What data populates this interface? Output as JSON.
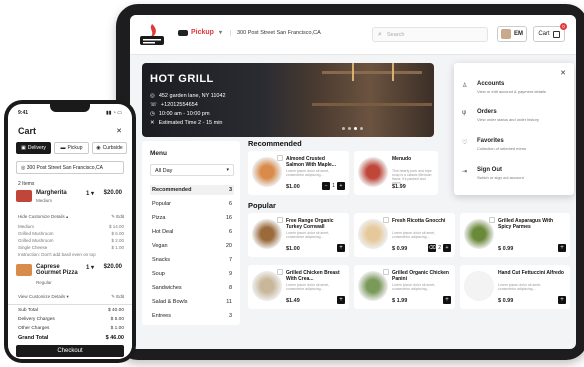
{
  "tablet": {
    "header": {
      "mode_label": "Pickup",
      "address": "300 Post Street San Francisco,CA",
      "search_placeholder": "Search",
      "user_initials": "EM",
      "cart_label": "Cart",
      "cart_count": "0"
    },
    "hero": {
      "title": "HOT GRILL",
      "address": "452 garden lane, NY 11042",
      "phone": "+12012554654",
      "hours": "10:00 am - 10:00 pm",
      "estimate": "Estimated Time 2 - 15 min"
    },
    "account_menu": {
      "items": [
        {
          "title": "Accounts",
          "subtitle": "View or edit account & payment details",
          "icon": "person-icon"
        },
        {
          "title": "Orders",
          "subtitle": "View order status and order history",
          "icon": "fork-knife-icon"
        },
        {
          "title": "Favorites",
          "subtitle": "Collection of selected menu",
          "icon": "heart-icon"
        },
        {
          "title": "Sign Out",
          "subtitle": "Switch or sign out account",
          "icon": "sign-out-icon"
        }
      ]
    },
    "menu": {
      "heading": "Menu",
      "selected_period": "All Day",
      "categories": [
        {
          "name": "Recommended",
          "count": "3"
        },
        {
          "name": "Popular",
          "count": "6"
        },
        {
          "name": "Pizza",
          "count": "16"
        },
        {
          "name": "Hot Deal",
          "count": "6"
        },
        {
          "name": "Vegan",
          "count": "20"
        },
        {
          "name": "Snacks",
          "count": "7"
        },
        {
          "name": "Soup",
          "count": "9"
        },
        {
          "name": "Sandwiches",
          "count": "8"
        },
        {
          "name": "Salad & Bowls",
          "count": "11"
        },
        {
          "name": "Entrees",
          "count": "3"
        }
      ]
    },
    "recommended": {
      "heading": "Recommended",
      "items": [
        {
          "name": "Almond Crusted Salmon With Maple...",
          "desc": "Lorem ipsum dolor sit amet, consectetur adipiscing...",
          "price": "$1.00",
          "qty": "1"
        },
        {
          "name": "Menudo",
          "desc": "This hearty pork and tripe soup is a classic Mexican flavor, it's packed and warm...",
          "price": "$1.99"
        }
      ]
    },
    "popular": {
      "heading": "Popular",
      "items": [
        {
          "name": "Free Range Organic Turkey Cornwall",
          "desc": "Lorem ipsum dolor sit amet, consectetur adipiscing...",
          "price": "$1.00"
        },
        {
          "name": "Fresh Ricotta Gnocchi",
          "desc": "Lorem ipsum dolor sit amet, consectetur adipiscing...",
          "price": "$ 0.99",
          "qty": "2"
        },
        {
          "name": "Grilled Asparagus With Spicy Parmes",
          "desc": "",
          "price": "$ 0.99"
        },
        {
          "name": "Grilled Chicken Breast With Crea...",
          "desc": "Lorem ipsum dolor sit amet, consectetur adipiscing...",
          "price": "$1.49"
        },
        {
          "name": "Grilled Organic Chicken Panini",
          "desc": "Lorem ipsum dolor sit amet, consectetur adipiscing...",
          "price": "$ 1.99"
        },
        {
          "name": "Hand Cut Fettuccini Alfredo",
          "desc": "Lorem ipsum dolor sit amet, consectetur adipiscing...",
          "price": "$ 0.99"
        }
      ]
    }
  },
  "phone": {
    "time": "9:41",
    "title": "Cart",
    "tabs": [
      "Delivery",
      "Pickup",
      "Curbside"
    ],
    "address": "300 Post Street San Francisco,CA",
    "item_count": "2 Items",
    "items": [
      {
        "name": "Margherita",
        "size": "Medium",
        "qty": "1",
        "price": "$20.00"
      },
      {
        "name": "Caprese Gourmet Pizza",
        "size": "Regular",
        "qty": "1",
        "price": "$20.00"
      }
    ],
    "hide_customize": "Hide Customize Details",
    "edit_label": "Edit",
    "view_customize": "View Customize Details",
    "options": [
      {
        "name": "Medium",
        "price": "$ 14.00"
      },
      {
        "name": "Grilled Mushroom",
        "price": "$ 6.00"
      },
      {
        "name": "Grilled Mushroom",
        "price": "$ 2.00"
      },
      {
        "name": "Single Cheese",
        "price": "$ 1.00"
      }
    ],
    "instruction": "Instruction: Don't add basil even on top",
    "totals": [
      {
        "label": "Sub Total",
        "value": "$ 40.00"
      },
      {
        "label": "Delivery Charges",
        "value": "$ 5.00"
      },
      {
        "label": "Other Charges",
        "value": "$ 1.00"
      }
    ],
    "grand_total_label": "Grand Total",
    "grand_total_value": "$ 46.00",
    "checkout_label": "Checkout"
  }
}
